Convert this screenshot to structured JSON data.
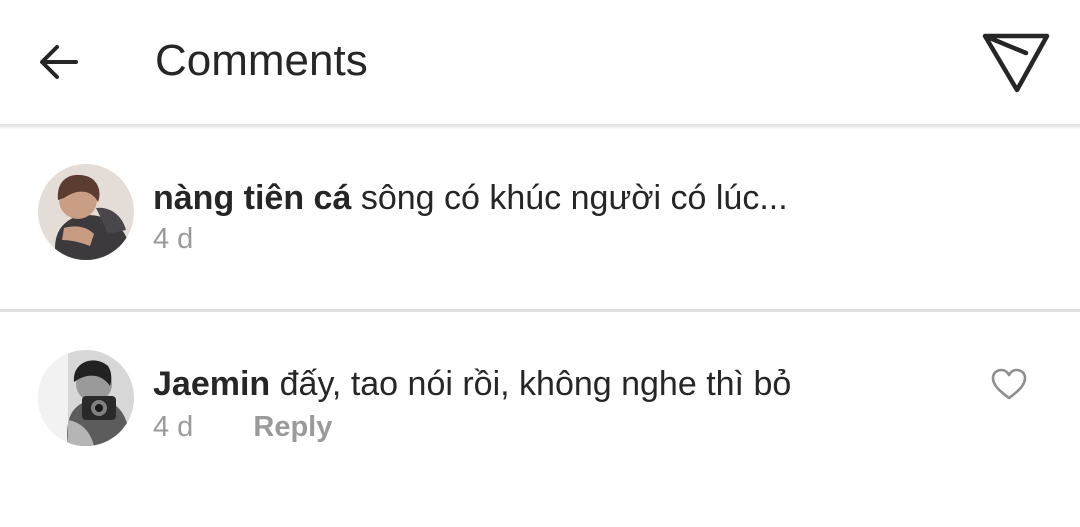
{
  "header": {
    "title": "Comments"
  },
  "icons": {
    "back": "arrow-left-icon",
    "send": "paper-plane-icon",
    "like": "heart-outline-icon"
  },
  "caption": {
    "username": "nàng tiên cá",
    "text": "sông có khúc người có lúc...",
    "time": "4 d"
  },
  "comments": [
    {
      "username": "Jaemin",
      "text": "đấy, tao nói rồi, không nghe thì bỏ",
      "time": "4 d",
      "reply_label": "Reply"
    }
  ],
  "colors": {
    "text": "#262626",
    "meta": "#9a9a9a",
    "divider": "#dedede",
    "background": "#ffffff"
  }
}
